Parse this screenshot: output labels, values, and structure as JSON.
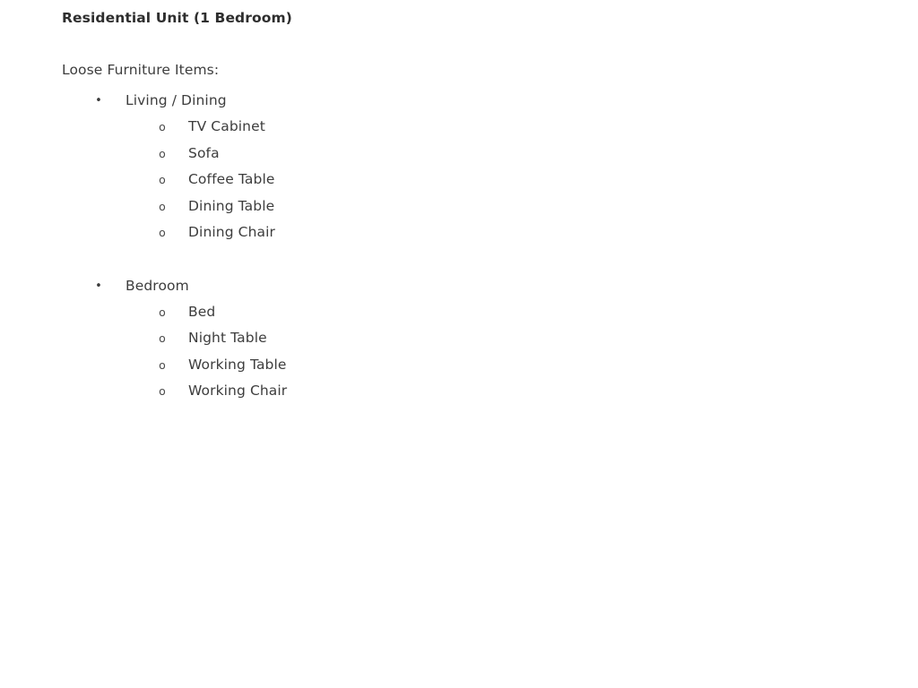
{
  "document": {
    "title": "Residential Unit (1 Bedroom)",
    "intro": "Loose Furniture Items:",
    "bullet_level1_marker": "•",
    "bullet_level2_marker": "o",
    "text_color": "#3d3d3d",
    "title_color": "#2e2e2e",
    "background_color": "#ffffff",
    "groups": [
      {
        "label": "Living / Dining",
        "items": [
          {
            "label": "TV Cabinet"
          },
          {
            "label": "Sofa"
          },
          {
            "label": "Coffee Table"
          },
          {
            "label": "Dining Table"
          },
          {
            "label": "Dining Chair"
          }
        ]
      },
      {
        "label": "Bedroom",
        "items": [
          {
            "label": "Bed"
          },
          {
            "label": "Night Table"
          },
          {
            "label": "Working Table"
          },
          {
            "label": "Working Chair"
          }
        ]
      }
    ]
  }
}
